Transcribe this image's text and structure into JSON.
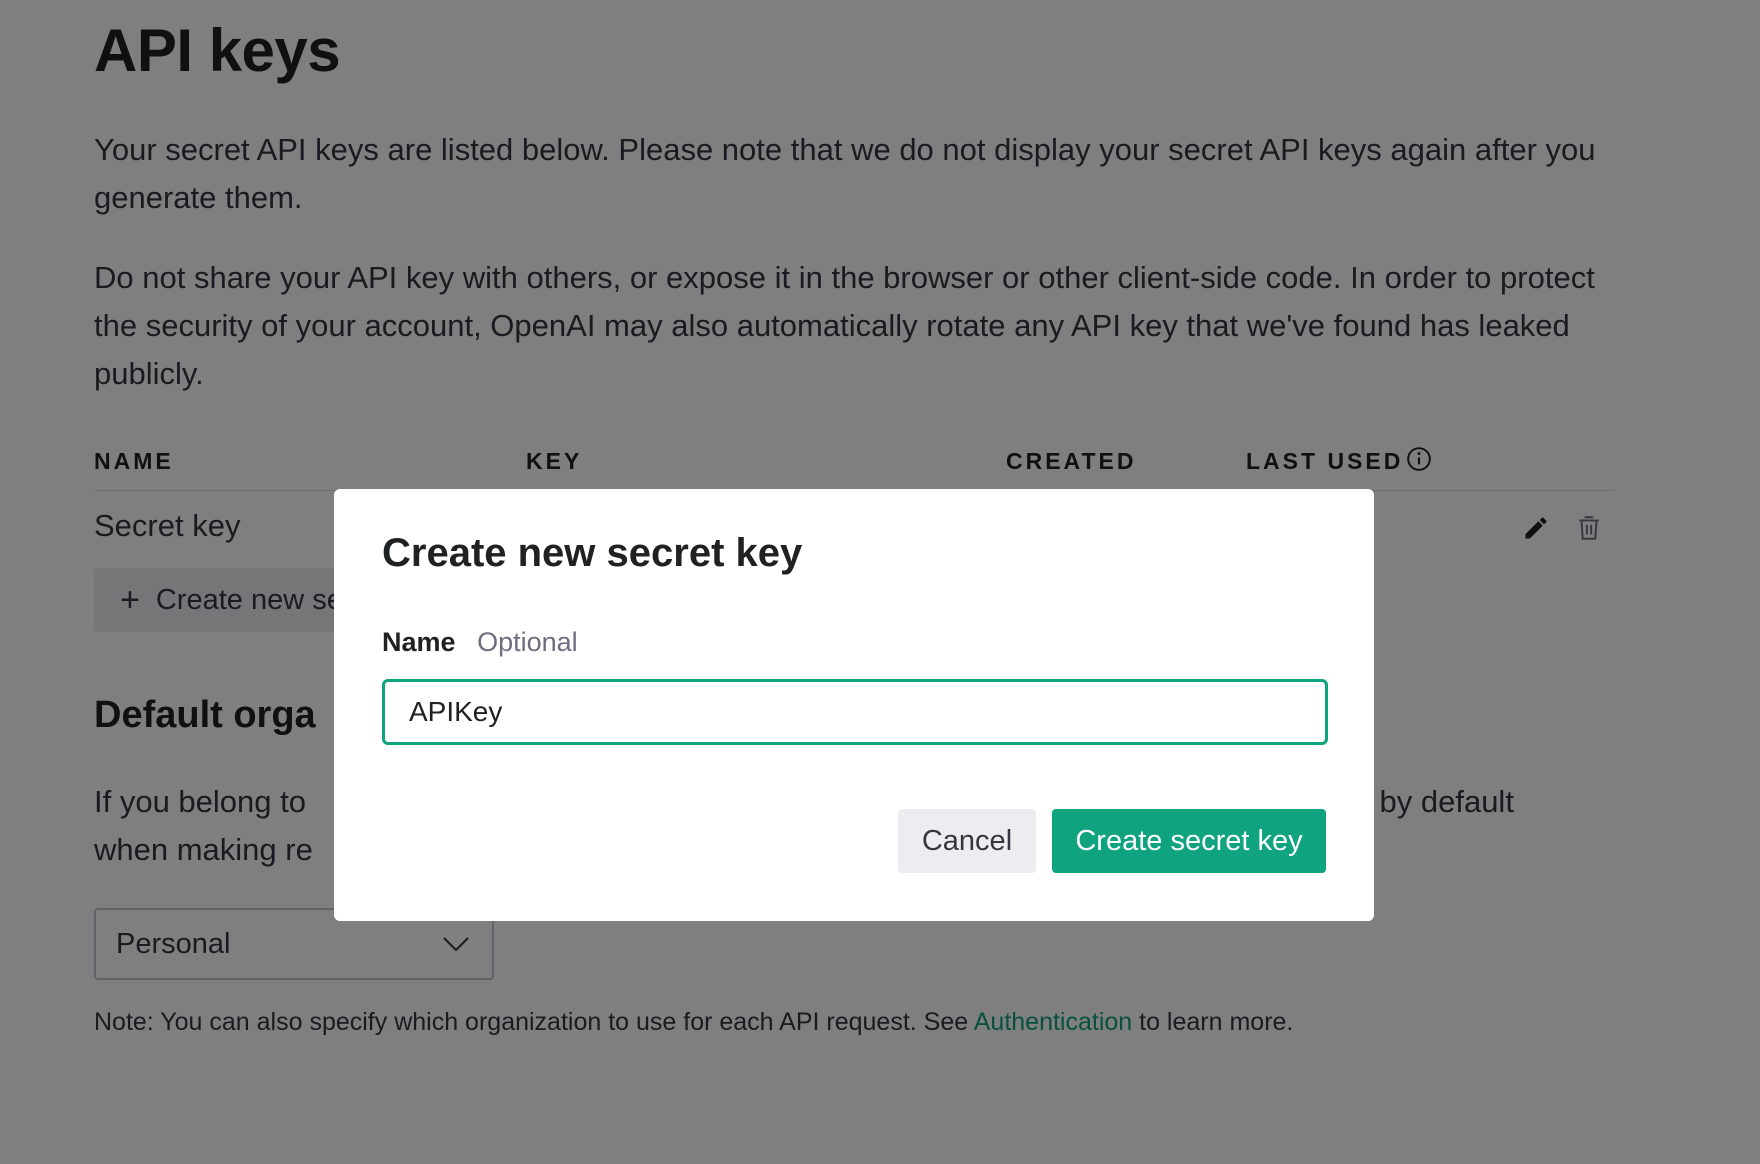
{
  "page": {
    "title": "API keys",
    "intro": "Your secret API keys are listed below. Please note that we do not display your secret API keys again after you generate them.",
    "warning": "Do not share your API key with others, or expose it in the browser or other client-side code. In order to protect the security of your account, OpenAI may also automatically rotate any API key that we've found has leaked publicly."
  },
  "table": {
    "headers": [
      "NAME",
      "KEY",
      "CREATED",
      "LAST USED"
    ],
    "rows": [
      {
        "name": "Secret key"
      }
    ],
    "icons": {
      "info": "info-icon",
      "edit": "pencil-icon",
      "delete": "trash-icon"
    }
  },
  "create_button": {
    "label": "Create new se"
  },
  "default_org": {
    "title": "Default orga",
    "description_left": "If you belong to",
    "description_right": "l by default",
    "description_line2": "when making re",
    "select_value": "Personal"
  },
  "note": {
    "prefix": "Note: You can also specify which organization to use for each API request. See ",
    "link": "Authentication",
    "suffix": " to learn more."
  },
  "modal": {
    "title": "Create new secret key",
    "name_label": "Name",
    "optional_label": "Optional",
    "input_value": "APIKey",
    "cancel_label": "Cancel",
    "submit_label": "Create secret key"
  },
  "colors": {
    "accent": "#10a37f",
    "overlay": "rgba(0,0,0,0.5)",
    "button_secondary": "#ececf1"
  }
}
